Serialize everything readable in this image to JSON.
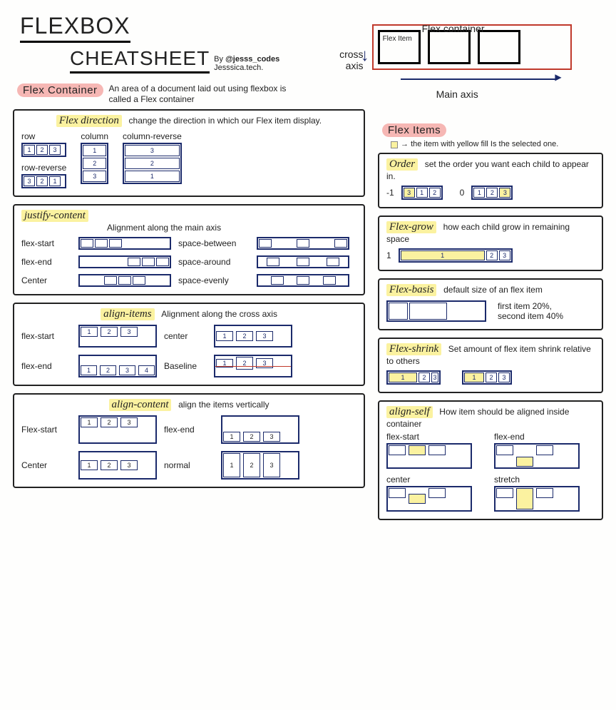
{
  "title1": "FlexBox",
  "title2": "Cheatsheet",
  "byline_by": "By",
  "byline_handle": "@jesss_codes",
  "byline_site": "Jesssica.tech.",
  "diagram": {
    "container_label": "Flex container",
    "cross_axis": "cross axis",
    "main_axis": "Main axis",
    "item_label": "Flex Item"
  },
  "flex_container": {
    "heading": "Flex Container",
    "desc": "An area of a document laid out using flexbox is called a Flex container"
  },
  "flex_direction": {
    "prop": "Flex direction",
    "desc": "change the direction in which our Flex item display.",
    "row": "row",
    "row_reverse": "row-reverse",
    "column": "column",
    "column_reverse": "column-reverse"
  },
  "justify_content": {
    "prop": "justify-content",
    "desc": "Alignment along the main axis",
    "flex_start": "flex-start",
    "flex_end": "flex-end",
    "center": "Center",
    "space_between": "space-between",
    "space_around": "space-around",
    "space_evenly": "space-evenly"
  },
  "align_items": {
    "prop": "align-items",
    "desc": "Alignment along the cross axis",
    "flex_start": "flex-start",
    "flex_end": "flex-end",
    "center": "center",
    "baseline": "Baseline"
  },
  "align_content": {
    "prop": "align-content",
    "desc": "align the items vertically",
    "flex_start": "Flex-start",
    "flex_end": "flex-end",
    "center": "Center",
    "normal": "normal"
  },
  "flex_items": {
    "heading": "Flex Items",
    "note": "the item with yellow fill Is the selected one."
  },
  "order": {
    "prop": "Order",
    "desc": "set the order you want each child to appear in.",
    "neg1": "-1",
    "zero": "0"
  },
  "flex_grow": {
    "prop": "Flex-grow",
    "desc": "how each child grow in remaining space",
    "val": "1"
  },
  "flex_basis": {
    "prop": "Flex-basis",
    "desc": "default size of an flex item",
    "line1": "first item 20%,",
    "line2": "second item 40%"
  },
  "flex_shrink": {
    "prop": "Flex-shrink",
    "desc": "Set amount of flex item shrink relative to others"
  },
  "align_self": {
    "prop": "align-self",
    "desc": "How item should be aligned inside container",
    "flex_start": "flex-start",
    "flex_end": "flex-end",
    "center": "center",
    "stretch": "stretch"
  },
  "nums": {
    "n1": "1",
    "n2": "2",
    "n3": "3",
    "n4": "4"
  }
}
